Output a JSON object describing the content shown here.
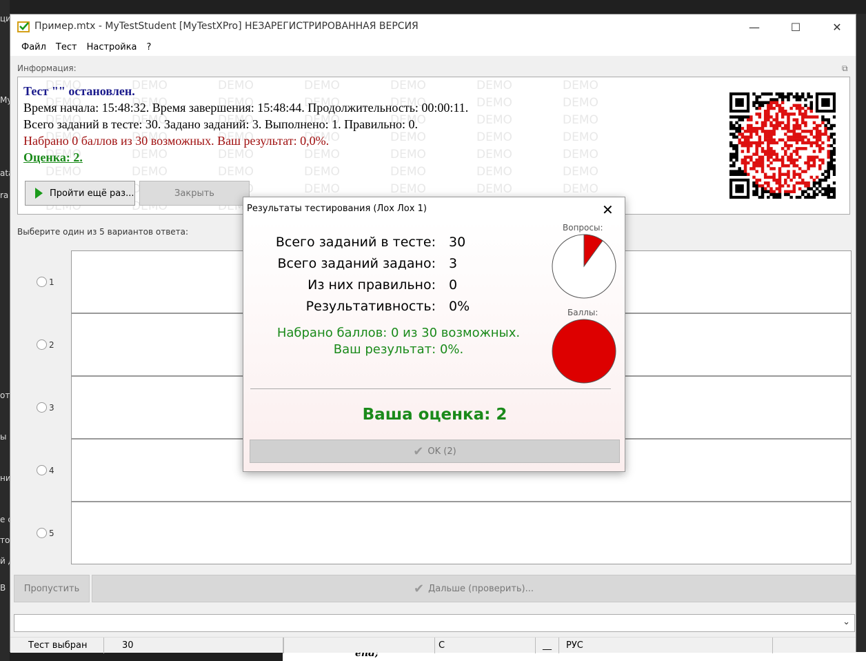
{
  "window": {
    "title": "Пример.mtx - MyTestStudent [MyTestXPro] НЕЗАРЕГИСТРИРОВАННАЯ ВЕРСИЯ",
    "minimize": "—",
    "maximize": "☐",
    "close": "✕"
  },
  "menu": [
    "Файл",
    "Тест",
    "Настройка",
    "?"
  ],
  "info": {
    "label": "Информация:",
    "expand_icon": "⧉",
    "demo_word": "DEMO",
    "title_line": "Тест \"\" остановлен.",
    "time_line": "Время начала: 15:48:32. Время завершения: 15:48:44. Продолжительность: 00:00:11.",
    "count_line": "Всего заданий в тесте: 30. Задано заданий: 3. Выполнено: 1. Правильно: 0.",
    "score_line": "Набрано 0 баллов из 30 возможных. Ваш результат: 0,0%.",
    "grade_line": "Оценка: 2.",
    "retry_button": "Пройти ещё раз...",
    "close_button": "Закрыть"
  },
  "question": {
    "instruction": "Выберите один из 5 вариантов ответа:",
    "options": [
      "1",
      "2",
      "3",
      "4",
      "5"
    ]
  },
  "buttons": {
    "skip": "Пропустить",
    "next": "Дальше (проверить)...",
    "check_glyph": "✔"
  },
  "combo": {
    "arrow": "⌄"
  },
  "status": {
    "selected": "Тест выбран",
    "count": "30",
    "c": "C",
    "underscore": "__",
    "lang": "РУС"
  },
  "dialog": {
    "title": "Результаты тестирования (Лох Лох 1)",
    "close": "✕",
    "stats": [
      {
        "label": "Всего заданий в тесте:",
        "value": "30"
      },
      {
        "label": "Всего заданий задано:",
        "value": "3"
      },
      {
        "label": "Из них правильно:",
        "value": "0"
      },
      {
        "label": "Результативность:",
        "value": "0%"
      }
    ],
    "score_line1": "Набрано баллов: 0 из 30 возможных.",
    "score_line2": "Ваш результат: 0%.",
    "grade": "Ваша оценка: 2",
    "ok_button": "OK (2)",
    "questions_label": "Вопросы:",
    "points_label": "Баллы:",
    "questions_asked_fraction": 0.1,
    "points_fraction": 0.0,
    "pie_red": "#dd0000"
  },
  "background": {
    "left_snippets": [
      "ци",
      "My",
      "ata",
      "ra",
      "от",
      "ы",
      "ни",
      "е с",
      "то",
      "й д",
      "В"
    ],
    "doc_text": "end;"
  }
}
